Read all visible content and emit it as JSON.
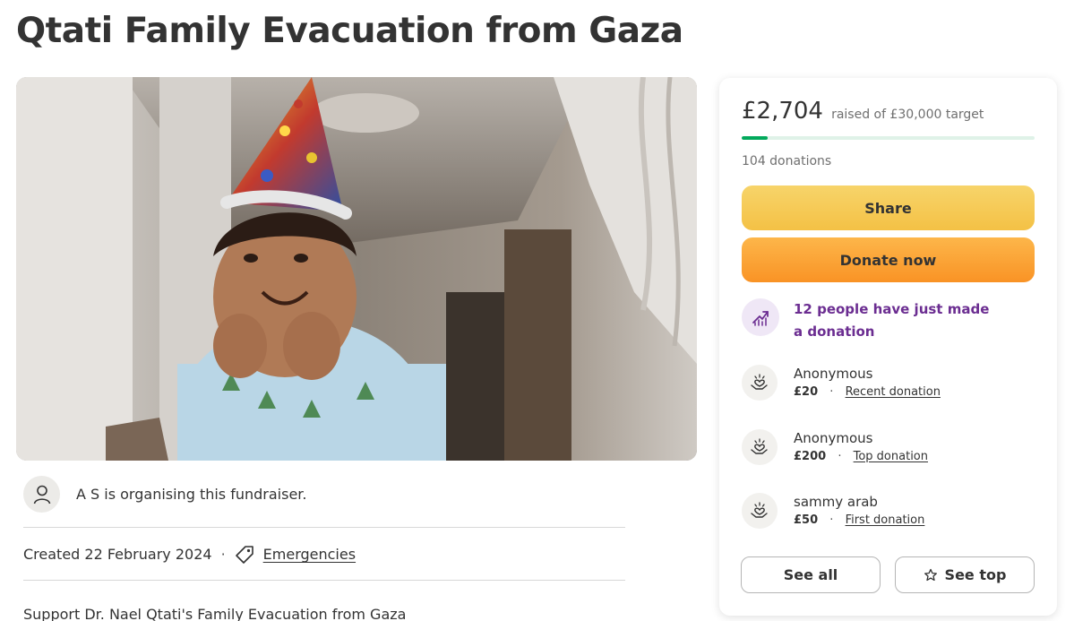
{
  "page": {
    "title": "Qtati Family Evacuation from Gaza"
  },
  "hero_image": {
    "description_icon": "photo-child-party-hat"
  },
  "organiser": {
    "icon": "user-icon",
    "text": "A S is organising this fundraiser."
  },
  "meta": {
    "created": "Created 22 February 2024",
    "separator": "·",
    "category_icon": "tag-icon",
    "category": "Emergencies"
  },
  "story": {
    "first_line": "Support Dr. Nael Qtati's Family Evacuation from Gaza"
  },
  "donation_card": {
    "raised_amount": "£2,704",
    "raised_text": "raised of £30,000 target",
    "progress_fraction": 0.09,
    "donation_count": "104 donations",
    "share_label": "Share",
    "donate_label": "Donate now",
    "trend_icon": "trending-up-icon",
    "trend_text": "12 people have just made a donation",
    "donors": [
      {
        "name": "Anonymous",
        "amount": "£20",
        "sep": "·",
        "tag": "Recent donation"
      },
      {
        "name": "Anonymous",
        "amount": "£200",
        "sep": "·",
        "tag": "Top donation"
      },
      {
        "name": "sammy arab",
        "amount": "£50",
        "sep": "·",
        "tag": "First donation"
      }
    ],
    "donor_icon": "heart-hand-icon",
    "see_all_label": "See all",
    "see_top_label": "See top",
    "see_top_icon": "star-icon"
  },
  "colors": {
    "progress_green": "#02a95c",
    "share_yellow": "#f4c145",
    "donate_orange": "#f99325",
    "trend_purple": "#6b2d91"
  }
}
